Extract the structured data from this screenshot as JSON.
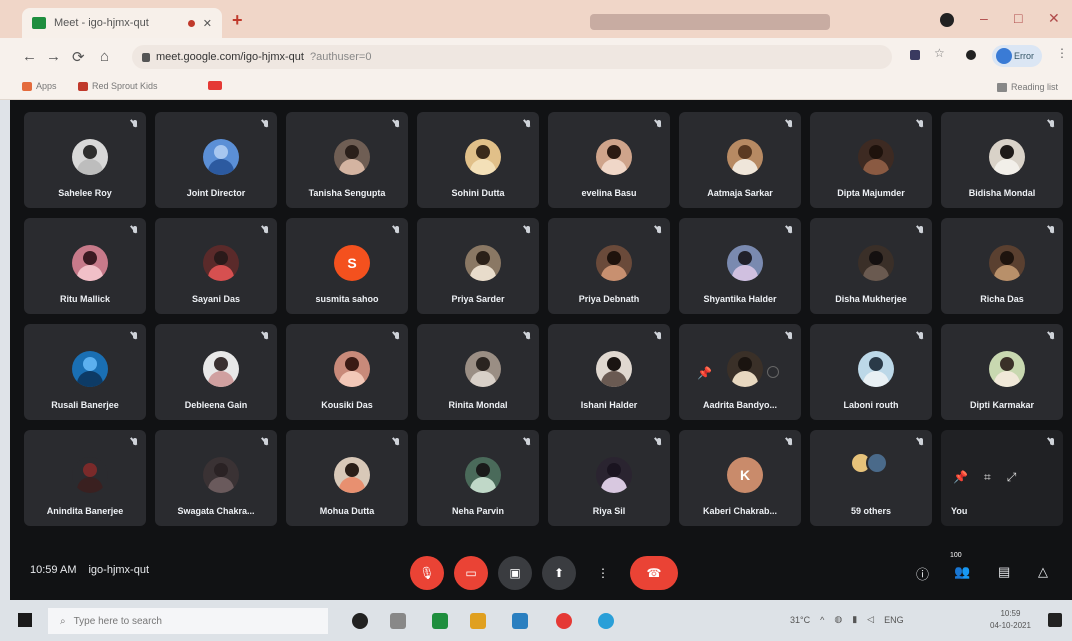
{
  "browser": {
    "tab_title": "Meet - igo-hjmx-qut",
    "url": "meet.google.com/igo-hjmx-qut",
    "url_rest": "?authuser=0",
    "bookmarks": [
      {
        "label": "Apps",
        "color": "#e46b3c"
      },
      {
        "label": "Red Sprout Kids",
        "color": "#c0392b"
      },
      {
        "label": "",
        "color": "#e53935"
      }
    ],
    "reading_list": "Reading list",
    "profile_label": "Error",
    "icons": [
      "back-icon",
      "forward-icon",
      "reload-icon",
      "home-icon",
      "lock-icon",
      "star-icon",
      "extensions-icon"
    ]
  },
  "meet": {
    "participants": [
      {
        "name": "Sahelee Roy",
        "avatar": "#d8d8d8",
        "head": "#2e2e2e",
        "body": "#bdbdbd"
      },
      {
        "name": "Joint Director",
        "avatar": "#5b8fd6",
        "head": "#a8c7f0",
        "body": "#2c5aa0"
      },
      {
        "name": "Tanisha Sengupta",
        "avatar": "#6f5e54",
        "head": "#2a1f1a",
        "body": "#d4b4a1"
      },
      {
        "name": "Sohini Dutta",
        "avatar": "#e1c089",
        "head": "#3a2a1a",
        "body": "#f3e0b8"
      },
      {
        "name": "evelina Basu",
        "avatar": "#cfa48b",
        "head": "#2c1a12",
        "body": "#f0d7c8"
      },
      {
        "name": "Aatmaja Sarkar",
        "avatar": "#b78a63",
        "head": "#5b3a22",
        "body": "#efe6da"
      },
      {
        "name": "Dipta Majumder",
        "avatar": "#3d2a22",
        "head": "#1e120c",
        "body": "#8a5a42"
      },
      {
        "name": "Bidisha Mondal",
        "avatar": "#d9d2c8",
        "head": "#1e1a18",
        "body": "#f2efe9"
      },
      {
        "name": "Ritu Mallick",
        "avatar": "#c77a8a",
        "head": "#3a1a22",
        "body": "#f1c0c8"
      },
      {
        "name": "Sayani Das",
        "avatar": "#5a2a2a",
        "head": "#2a1a1a",
        "body": "#d65050"
      },
      {
        "name": "susmita sahoo",
        "avatar": "#f4511e",
        "head": "#f4511e",
        "body": "#f4511e",
        "initial": "S"
      },
      {
        "name": "Priya Sarder",
        "avatar": "#8a7864",
        "head": "#2a2018",
        "body": "#e8dccb"
      },
      {
        "name": "Priya Debnath",
        "avatar": "#6a4a3a",
        "head": "#1e120c",
        "body": "#c89070"
      },
      {
        "name": "Shyantika Halder",
        "avatar": "#7a8ab0",
        "head": "#20202a",
        "body": "#d0c0e0"
      },
      {
        "name": "Disha Mukherjee",
        "avatar": "#3a2f28",
        "head": "#141010",
        "body": "#6a5a50"
      },
      {
        "name": "Richa Das",
        "avatar": "#5a4030",
        "head": "#1e140e",
        "body": "#b8906a"
      },
      {
        "name": "Rusali Banerjee",
        "avatar": "#1a6fb3",
        "head": "#5cb0ef",
        "body": "#0d3b66"
      },
      {
        "name": "Debleena Gain",
        "avatar": "#e8e8e8",
        "head": "#3a3030",
        "body": "#d0a0a0"
      },
      {
        "name": "Kousiki Das",
        "avatar": "#c88a7a",
        "head": "#3a1a14",
        "body": "#f2c8b8"
      },
      {
        "name": "Rinita Mondal",
        "avatar": "#9a8e84",
        "head": "#2a2420",
        "body": "#d8d0c8"
      },
      {
        "name": "Ishani Halder",
        "avatar": "#e0d8d0",
        "head": "#1a1412",
        "body": "#6a5a52"
      },
      {
        "name": "Aadrita Bandyo...",
        "avatar": "#3a3028",
        "head": "#1a1410",
        "body": "#e8d8c0"
      },
      {
        "name": "Laboni routh",
        "avatar": "#bcd8e8",
        "head": "#2a3a48",
        "body": "#e8f0f4"
      },
      {
        "name": "Dipti Karmakar",
        "avatar": "#c8d8b0",
        "head": "#3a3028",
        "body": "#f0e8d8"
      },
      {
        "name": "Anindita Banerjee",
        "avatar": "#2a2b2f",
        "head": "#7a2a2a",
        "body": "#3a2020"
      },
      {
        "name": "Swagata Chakra...",
        "avatar": "#3a3234",
        "head": "#2a2224",
        "body": "#6a5a5c"
      },
      {
        "name": "Mohua Dutta",
        "avatar": "#d8c8b8",
        "head": "#2a1e18",
        "body": "#e89070"
      },
      {
        "name": "Neha Parvin",
        "avatar": "#4a6a5a",
        "head": "#1a1a1a",
        "body": "#c0d8c8"
      },
      {
        "name": "Riya Sil",
        "avatar": "#2a2430",
        "head": "#1a1420",
        "body": "#d8c8e0"
      },
      {
        "name": "Kaberi Chakrab...",
        "avatar": "#c98b6b",
        "head": "#c98b6b",
        "body": "#c98b6b",
        "initial": "K"
      }
    ],
    "others_label": "59 others",
    "you_label": "You"
  },
  "controls": {
    "time": "10:59 AM",
    "meeting_code": "igo-hjmx-qut",
    "people_count": "100"
  },
  "taskbar": {
    "search_placeholder": "Type here to search",
    "temperature": "31°C",
    "lang": "ENG",
    "time": "10:59",
    "date": "04-10-2021"
  }
}
